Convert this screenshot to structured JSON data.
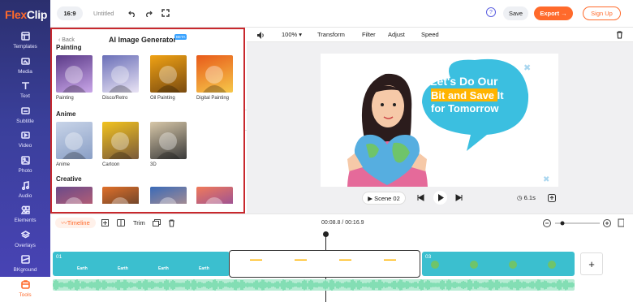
{
  "app": {
    "logo_a": "Flex",
    "logo_b": "Clip"
  },
  "sidebar": {
    "items": [
      {
        "label": "Templates",
        "icon": "templates-icon"
      },
      {
        "label": "Media",
        "icon": "media-icon"
      },
      {
        "label": "Text",
        "icon": "text-icon"
      },
      {
        "label": "Subtitle",
        "icon": "subtitle-icon"
      },
      {
        "label": "Video",
        "icon": "video-icon"
      },
      {
        "label": "Photo",
        "icon": "photo-icon"
      },
      {
        "label": "Audio",
        "icon": "audio-icon"
      },
      {
        "label": "Elements",
        "icon": "elements-icon"
      },
      {
        "label": "Overlays",
        "icon": "overlays-icon"
      },
      {
        "label": "BKground",
        "icon": "background-icon"
      },
      {
        "label": "Tools",
        "icon": "tools-icon",
        "active": true
      }
    ]
  },
  "topbar": {
    "ratio": "16:9",
    "project_title": "Untitled",
    "save": "Save",
    "export": "Export →",
    "signup": "Sign Up",
    "help": "?"
  },
  "panel": {
    "back": "Back",
    "title": "AI Image Generator",
    "beta": "BETA",
    "sections": [
      {
        "name": "Painting",
        "items": [
          "Painting",
          "Disco/Retro",
          "Oil Painting",
          "Digital Painting"
        ]
      },
      {
        "name": "Anime",
        "items": [
          "Anime",
          "Cartoon",
          "3D"
        ]
      },
      {
        "name": "Creative",
        "items": [
          "",
          "",
          "",
          ""
        ]
      }
    ]
  },
  "toolbar": {
    "zoom": "100%",
    "transform": "Transform",
    "filter": "Filter",
    "adjust": "Adjust",
    "speed": "Speed"
  },
  "canvas": {
    "headline_1": "Let's Do Our",
    "headline_2a": "Bit and Save",
    "headline_2b": " It",
    "headline_3": "for Tomorrow"
  },
  "player": {
    "scene": "Scene 02",
    "duration": "6.1s"
  },
  "timeline": {
    "label": "Timeline",
    "trim": "Trim",
    "time": "00:08.8 / 00:16.9",
    "clip1": "01",
    "clip3": "03",
    "add": "+"
  },
  "colors": {
    "accent": "#ff6a2b",
    "highlight_border": "#c8282d",
    "sidebar": "#3a3f9a",
    "clip_teal": "#3bbfcf"
  }
}
